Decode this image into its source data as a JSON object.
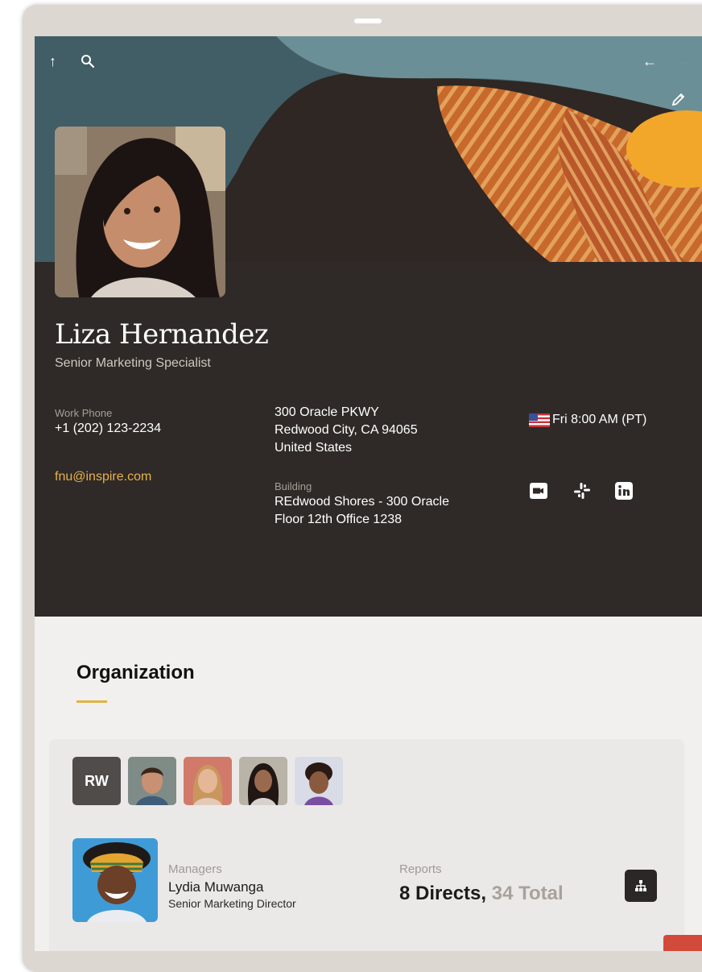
{
  "profile": {
    "name": "Liza Hernandez",
    "title": "Senior Marketing Specialist",
    "work_phone_label": "Work Phone",
    "work_phone": "+1 (202) 123-2234",
    "email": "fnu@inspire.com",
    "address_line1": "300 Oracle PKWY",
    "address_line2": "Redwood City, CA 94065",
    "address_line3": "United States",
    "building_label": "Building",
    "building_line1": "REdwood Shores - 300 Oracle",
    "building_line2": "Floor 12th Office 1238",
    "local_time": "Fri 8:00 AM (PT)"
  },
  "icons": {
    "back": "up-arrow-icon",
    "search": "search-icon",
    "nav_back": "left-arrow-icon",
    "nav_forward": "right-arrow-icon",
    "edit": "pencil-icon",
    "video": "video-icon",
    "slack": "slack-icon",
    "linkedin": "linkedin-icon",
    "hierarchy": "hierarchy-icon"
  },
  "organization": {
    "heading": "Organization",
    "team_initials": "RW",
    "managers_label": "Managers",
    "manager_name": "Lydia Muwanga",
    "manager_title": "Senior Marketing Director",
    "reports_label": "Reports",
    "directs": "8 Directs,",
    "total": "34 Total"
  },
  "colors": {
    "hero_bg": "#2f2a27",
    "email_accent": "#e7b14a",
    "underline_accent": "#e0b344",
    "teal_banner": "#6b8f96",
    "orange_banner": "#c8692c",
    "amber_banner": "#f2a72a"
  }
}
